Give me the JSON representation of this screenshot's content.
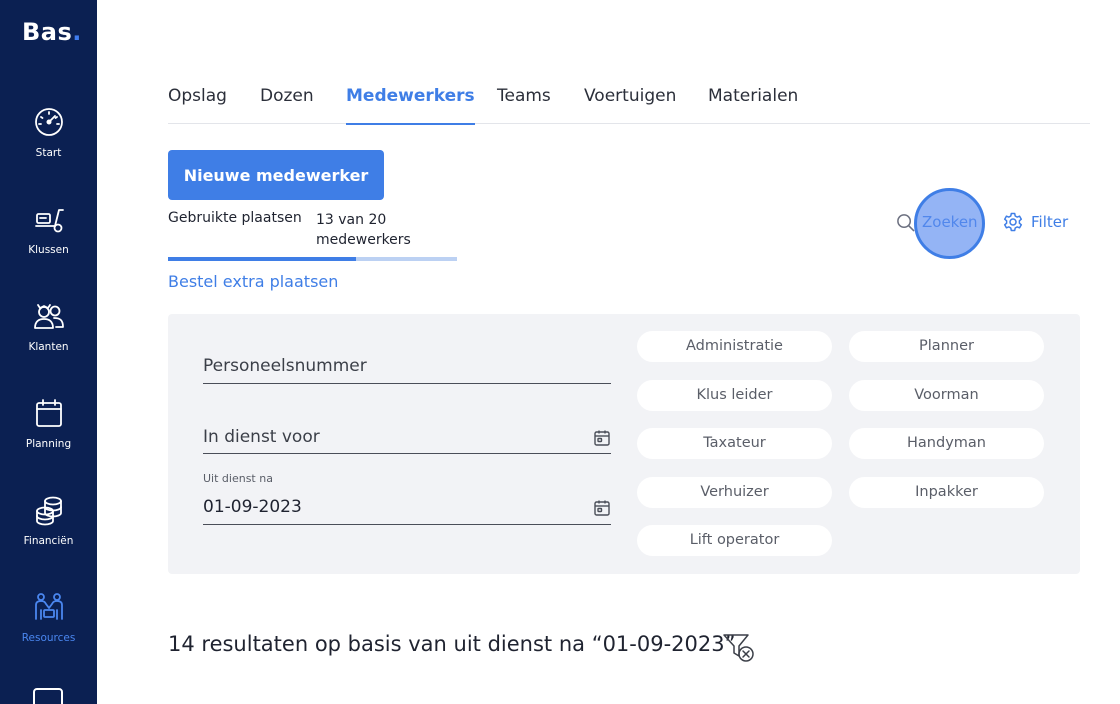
{
  "brand": {
    "name": "Bas",
    "dot": "."
  },
  "sidebar": {
    "items": [
      {
        "label": "Start",
        "icon": "gauge-icon"
      },
      {
        "label": "Klussen",
        "icon": "truck-dolly-icon"
      },
      {
        "label": "Klanten",
        "icon": "customers-icon"
      },
      {
        "label": "Planning",
        "icon": "calendar-icon"
      },
      {
        "label": "Financiën",
        "icon": "coins-icon"
      },
      {
        "label": "Resources",
        "icon": "team-icon",
        "active": true
      }
    ]
  },
  "tabs": [
    {
      "label": "Opslag"
    },
    {
      "label": "Dozen"
    },
    {
      "label": "Medewerkers",
      "active": true
    },
    {
      "label": "Teams"
    },
    {
      "label": "Voertuigen"
    },
    {
      "label": "Materialen"
    }
  ],
  "actions": {
    "new_employee": "Nieuwe medewerker",
    "search": "Zoeken",
    "filter": "Filter"
  },
  "seats": {
    "label": "Gebruikte plaatsen",
    "value": "13 van 20 medewerkers",
    "used": 13,
    "total": 20,
    "order_link": "Bestel extra plaatsen"
  },
  "filters": {
    "personnel_number_placeholder": "Personeelsnummer",
    "in_service_placeholder": "In dienst voor",
    "out_of_service_label": "Uit dienst na",
    "out_of_service_value": "01-09-2023",
    "roles": [
      "Administratie",
      "Planner",
      "Klus leider",
      "Voorman",
      "Taxateur",
      "Handyman",
      "Verhuizer",
      "Inpakker",
      "Lift operator"
    ]
  },
  "results": {
    "text": "14 resultaten op basis van uit dienst na “01-09-2023”"
  },
  "colors": {
    "sidebar_bg": "#0b2052",
    "accent": "#3f7ee6",
    "panel_bg": "#f2f3f6"
  }
}
